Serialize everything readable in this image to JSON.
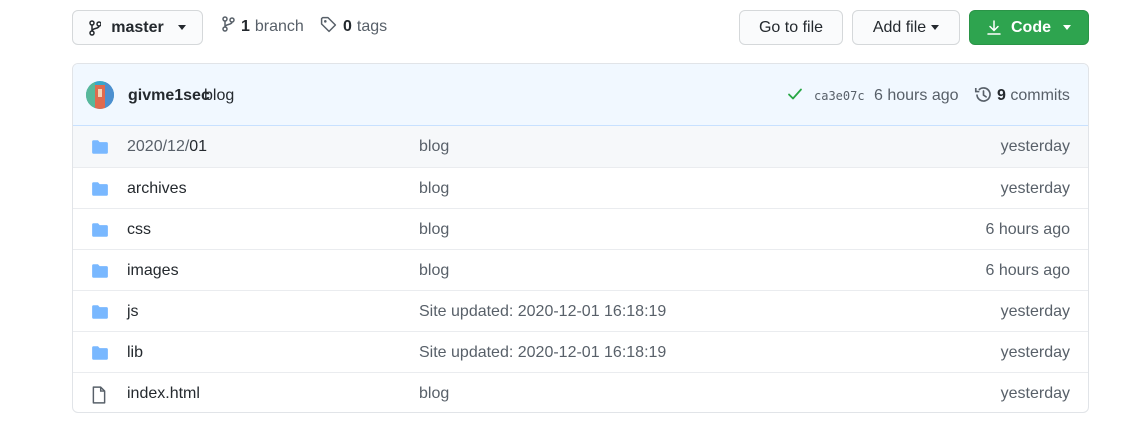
{
  "toolbar": {
    "branch_label": "master",
    "branch_count": "1",
    "branch_word": "branch",
    "tag_count": "0",
    "tag_word": "tags",
    "goto_label": "Go to file",
    "add_file_label": "Add file",
    "code_label": "Code",
    "accent_color": "#2ea44f"
  },
  "commit": {
    "author": "givme1sec",
    "message": "blog",
    "sha": "ca3e07c",
    "time": "6 hours ago",
    "commit_count": "9",
    "commit_word": "commits"
  },
  "files": [
    {
      "type": "directory",
      "name_prefix": "2020/12/",
      "name": "01",
      "message": "blog",
      "age": "yesterday"
    },
    {
      "type": "directory",
      "name_prefix": "",
      "name": "archives",
      "message": "blog",
      "age": "yesterday"
    },
    {
      "type": "directory",
      "name_prefix": "",
      "name": "css",
      "message": "blog",
      "age": "6 hours ago"
    },
    {
      "type": "directory",
      "name_prefix": "",
      "name": "images",
      "message": "blog",
      "age": "6 hours ago"
    },
    {
      "type": "directory",
      "name_prefix": "",
      "name": "js",
      "message": "Site updated: 2020-12-01 16:18:19",
      "age": "yesterday"
    },
    {
      "type": "directory",
      "name_prefix": "",
      "name": "lib",
      "message": "Site updated: 2020-12-01 16:18:19",
      "age": "yesterday"
    },
    {
      "type": "file",
      "name_prefix": "",
      "name": "index.html",
      "message": "blog",
      "age": "yesterday"
    }
  ]
}
